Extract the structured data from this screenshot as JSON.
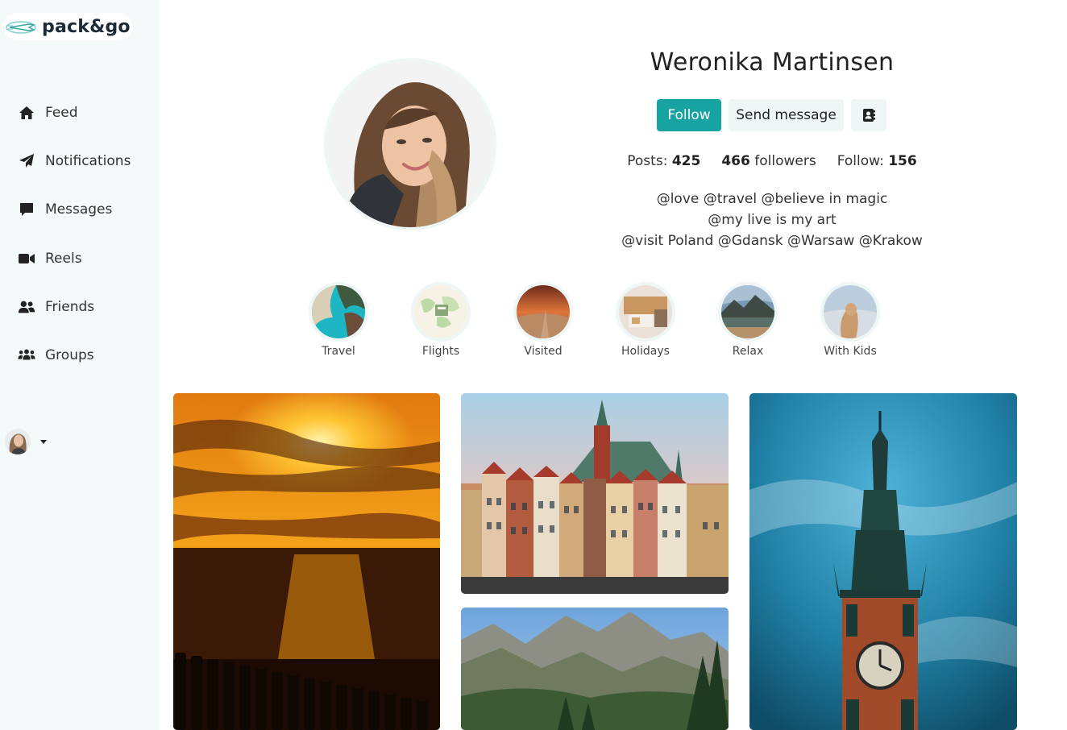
{
  "app": {
    "brand": "pack&go"
  },
  "sidebar": {
    "items": [
      {
        "label": "Feed",
        "icon": "home-icon"
      },
      {
        "label": "Notifications",
        "icon": "paper-plane-icon"
      },
      {
        "label": "Messages",
        "icon": "comment-icon"
      },
      {
        "label": "Reels",
        "icon": "video-camera-icon"
      },
      {
        "label": "Friends",
        "icon": "user-friends-icon"
      },
      {
        "label": "Groups",
        "icon": "users-icon"
      }
    ],
    "account_menu_icon": "caret-down-icon"
  },
  "profile": {
    "name": "Weronika Martinsen",
    "follow_label": "Follow",
    "message_label": "Send message",
    "contact_icon": "address-book-icon",
    "stats": {
      "posts_label": "Posts:",
      "posts": "425",
      "followers": "466",
      "followers_label": "followers",
      "follow_label": "Follow:",
      "follow": "156"
    },
    "bio": [
      "@love @travel @believe in magic",
      "@my live is my art",
      "@visit Poland @Gdansk @Warsaw @Krakow"
    ]
  },
  "highlights": [
    {
      "label": "Travel"
    },
    {
      "label": "Flights"
    },
    {
      "label": "Visited"
    },
    {
      "label": "Holidays"
    },
    {
      "label": "Relax"
    },
    {
      "label": "With Kids"
    }
  ],
  "colors": {
    "accent": "#16a3a1",
    "sidebar_bg": "#f4fafa",
    "button_light": "#eef6f6"
  }
}
